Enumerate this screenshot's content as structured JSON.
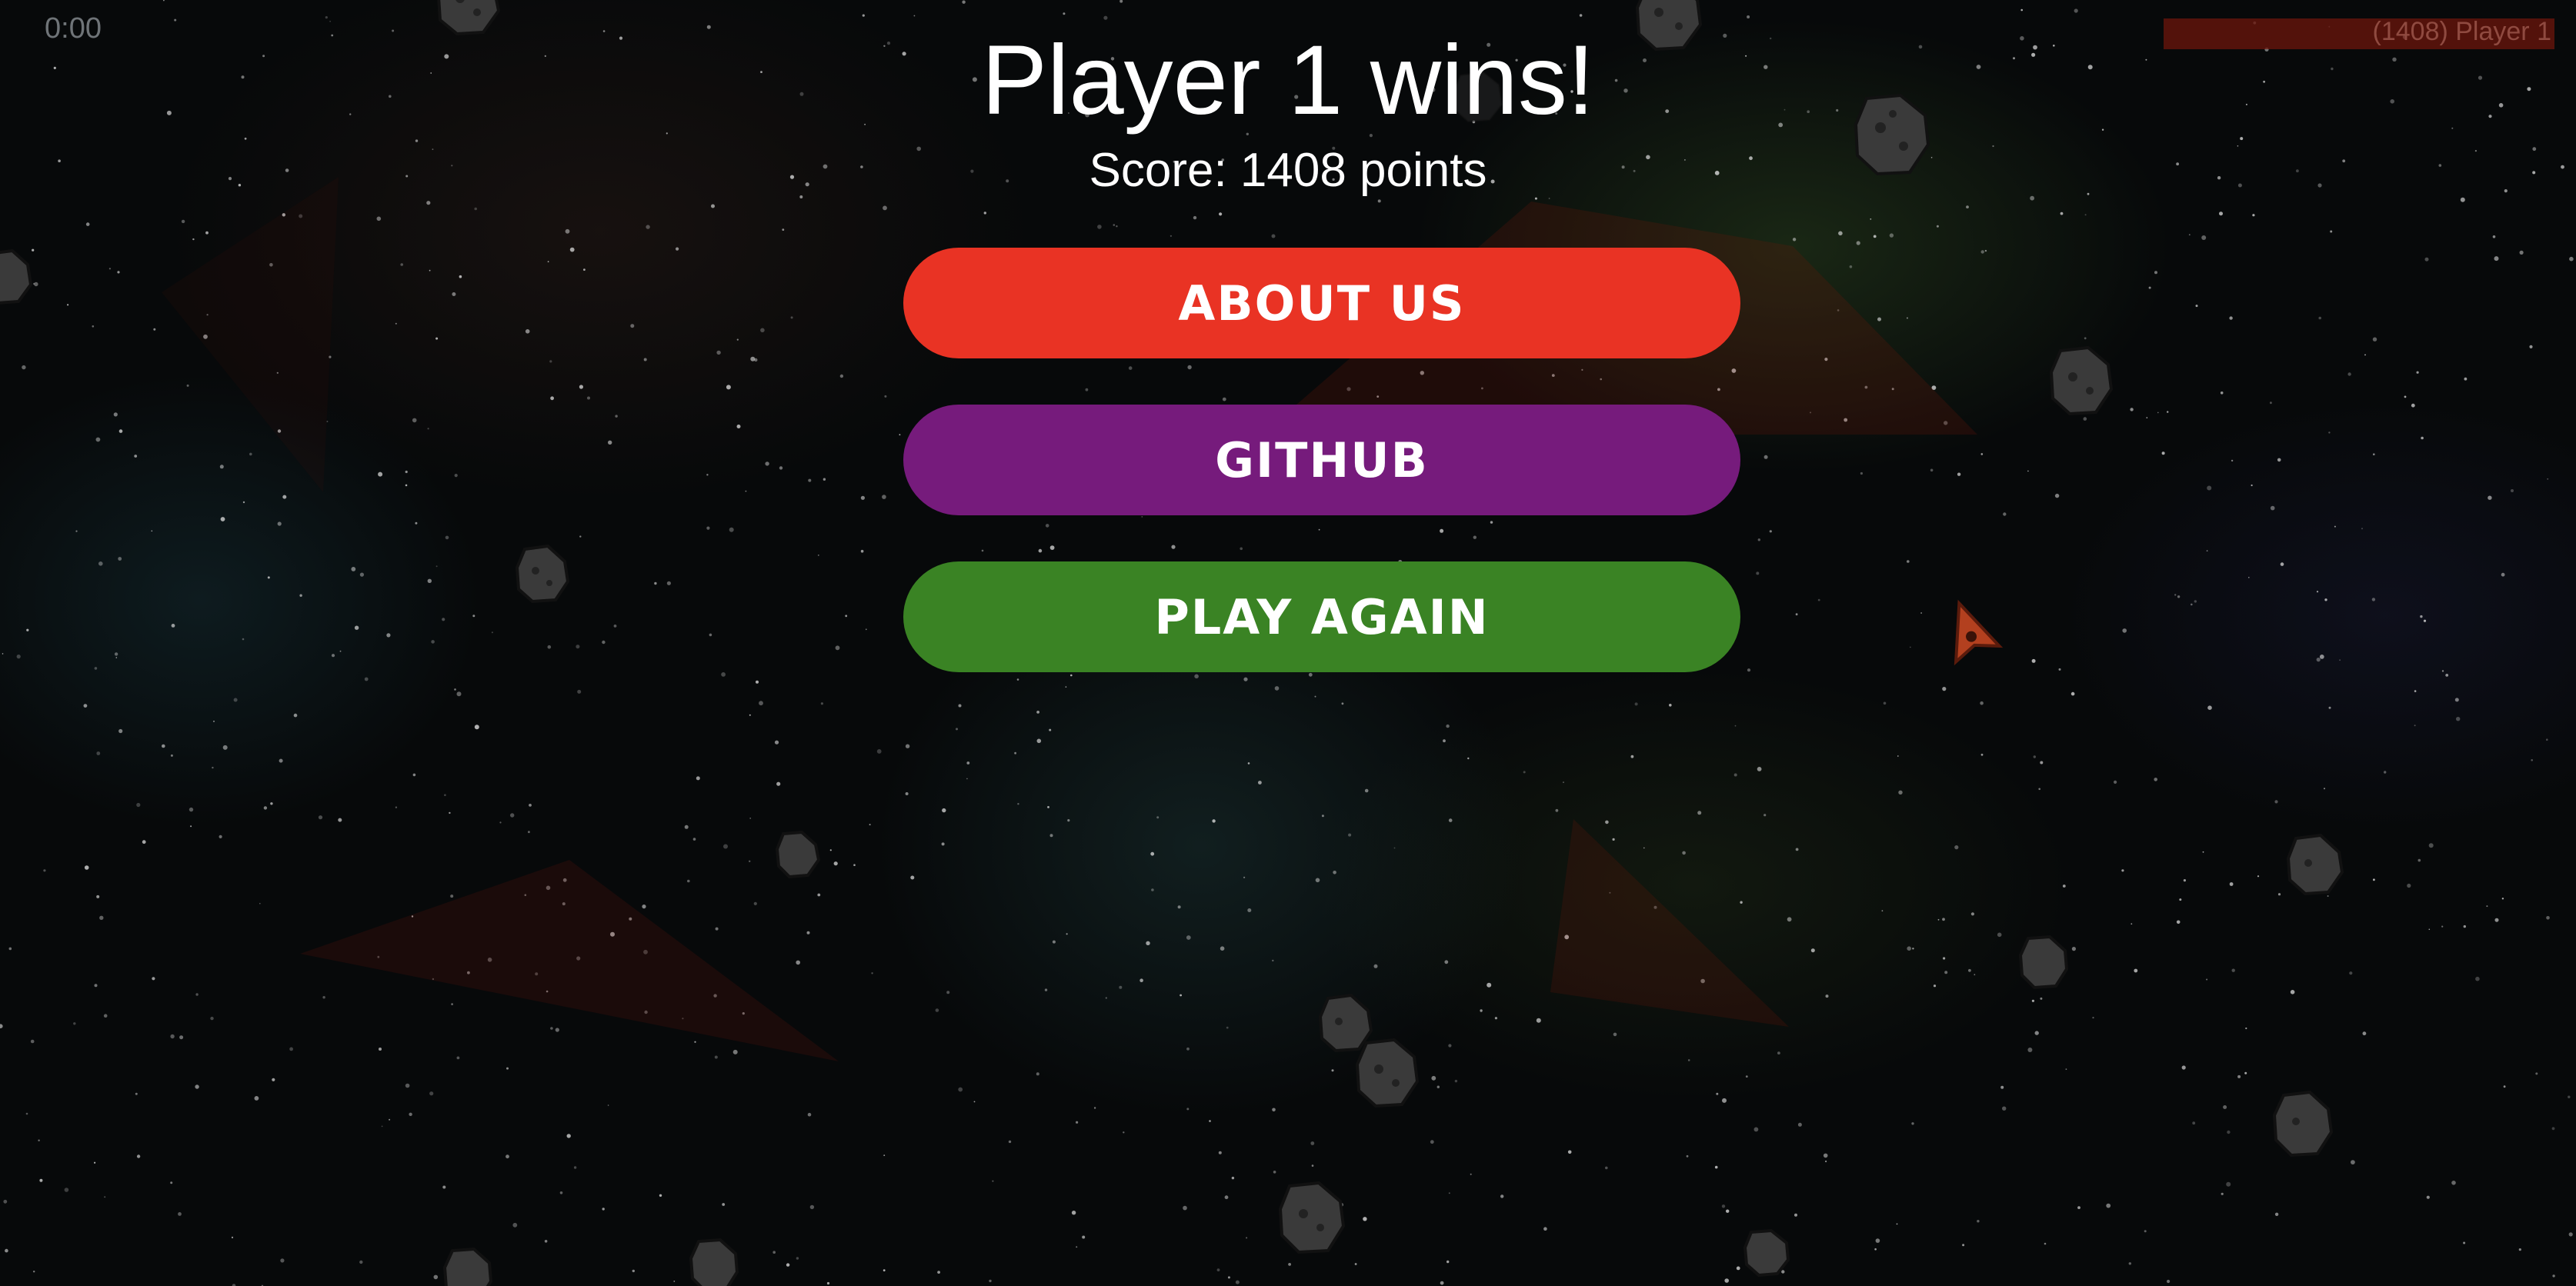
{
  "hud": {
    "timer": "0:00",
    "leaderboard_entry": "(1408) Player 1"
  },
  "result": {
    "title": "Player 1 wins!",
    "score": "Score: 1408 points"
  },
  "menu": {
    "about_label": "ABOUT US",
    "github_label": "GITHUB",
    "play_again_label": "PLAY AGAIN"
  },
  "colors": {
    "about_button": "#e93324",
    "github_button": "#761b7c",
    "play_again_button": "#3a8324",
    "leaderboard_bar": "#6e160c",
    "background": "#07090a"
  },
  "icons": [
    "asteroid-icon",
    "player-ship-icon"
  ]
}
